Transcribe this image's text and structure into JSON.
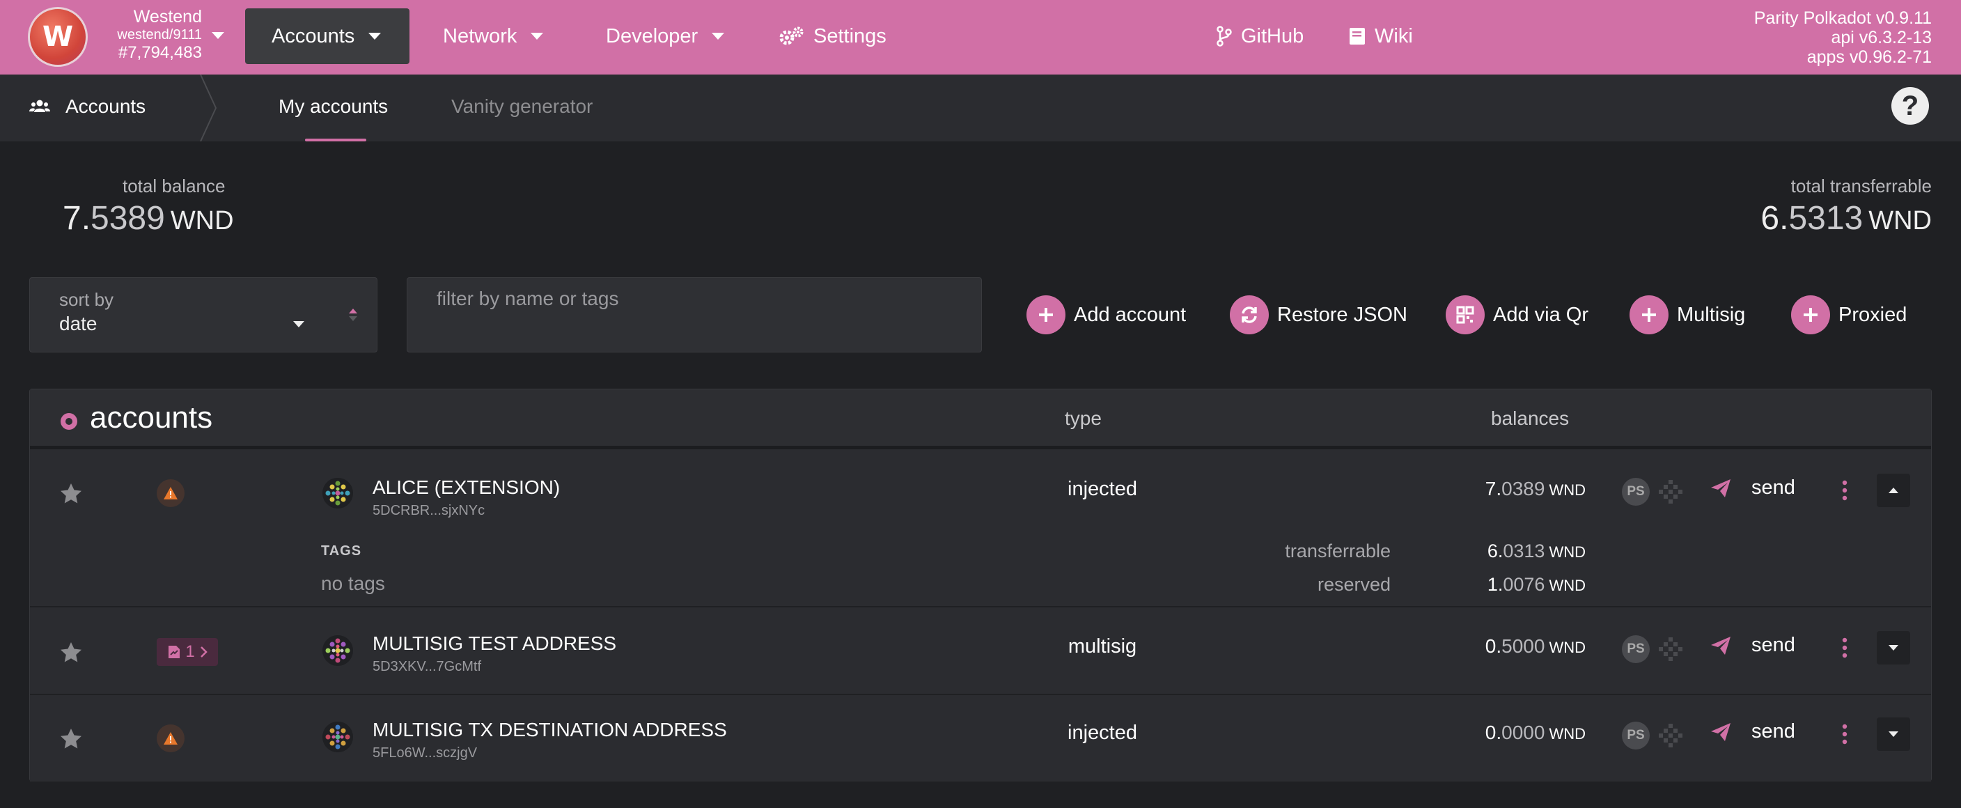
{
  "chain": {
    "name": "Westend",
    "spec": "westend/9111",
    "block": "#7,794,483"
  },
  "nav": {
    "accounts": "Accounts",
    "network": "Network",
    "developer": "Developer",
    "settings": "Settings",
    "github": "GitHub",
    "wiki": "Wiki"
  },
  "version": {
    "node": "Parity Polkadot v0.9.11",
    "api": "api v6.3.2-13",
    "apps": "apps v0.96.2-71"
  },
  "subnav": {
    "section": "Accounts",
    "tabs": [
      "My accounts",
      "Vanity generator"
    ],
    "active_tab": "My accounts",
    "help": "?"
  },
  "summary": {
    "total_balance_label": "total balance",
    "total_balance_int": "7.",
    "total_balance_dec": "5389",
    "total_transferrable_label": "total transferrable",
    "total_transferrable_int": "6.",
    "total_transferrable_dec": "5313",
    "unit": "WND"
  },
  "sort": {
    "label": "sort by",
    "value": "date"
  },
  "filter": {
    "placeholder": "filter by name or tags",
    "value": ""
  },
  "actions": {
    "add_account": "Add account",
    "restore_json": "Restore JSON",
    "add_via_qr": "Add via Qr",
    "multisig": "Multisig",
    "proxied": "Proxied"
  },
  "table": {
    "title": "accounts",
    "col_type": "type",
    "col_balances": "balances",
    "unit": "WND",
    "send_label": "send",
    "ps_label": "PS",
    "rows": [
      {
        "name": "ALICE (EXTENSION)",
        "address": "5DCRBR...sjxNYc",
        "type": "injected",
        "balance_int": "7.",
        "balance_dec": "0389",
        "expanded": true,
        "tags_label": "TAGS",
        "tags_value": "no tags",
        "transferrable_label": "transferrable",
        "transferrable_int": "6.",
        "transferrable_dec": "0313",
        "reserved_label": "reserved",
        "reserved_int": "1.",
        "reserved_dec": "0076"
      },
      {
        "name": "MULTISIG TEST ADDRESS",
        "address": "5D3XKV...7GcMtf",
        "type": "multisig",
        "balance_int": "0.",
        "balance_dec": "5000",
        "badge_count": "1"
      },
      {
        "name": "MULTISIG TX DESTINATION ADDRESS",
        "address": "5FLo6W...sczjgV",
        "type": "injected",
        "balance_int": "0.",
        "balance_dec": "0000"
      }
    ]
  },
  "colors": {
    "accent": "#d170a6",
    "background": "#1f2023",
    "panel": "#2b2c30",
    "warning": "#e8782c"
  }
}
